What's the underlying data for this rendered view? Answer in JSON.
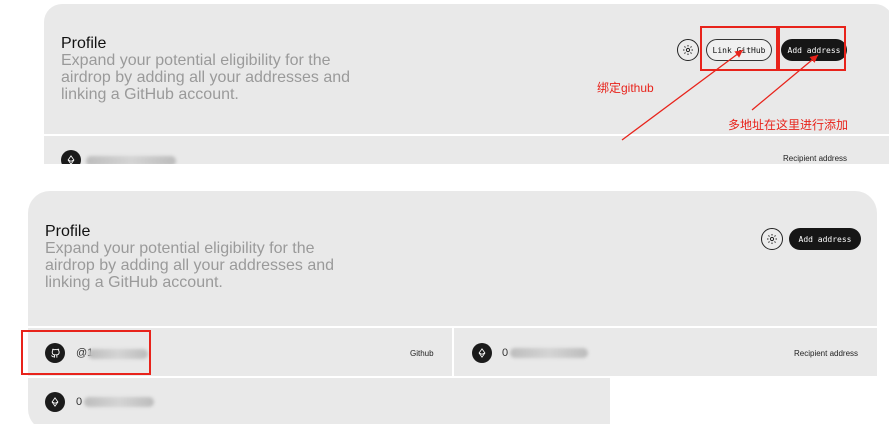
{
  "panel_before": {
    "title": "Profile",
    "description": "Expand your potential eligibility for the airdrop by adding all your addresses and linking a GitHub account.",
    "link_github_label": "Link GitHub",
    "add_address_label": "Add address",
    "recipient_label": "Recipient address"
  },
  "annotations": {
    "bind_github": "绑定github",
    "multi_address": "多地址在这里进行添加"
  },
  "panel_after": {
    "title": "Profile",
    "description": "Expand your potential eligibility for the airdrop by adding all your addresses and linking a GitHub account.",
    "add_address_label": "Add address",
    "github_handle_prefix": "@1",
    "github_tag": "Github",
    "address_prefix_1": "0",
    "recipient_label": "Recipient address",
    "address_prefix_2": "0"
  },
  "colors": {
    "panel_bg": "#e9e9e9",
    "annotation_red": "#e8231b",
    "dark_button": "#161616",
    "muted_text": "#9a9a9a"
  }
}
